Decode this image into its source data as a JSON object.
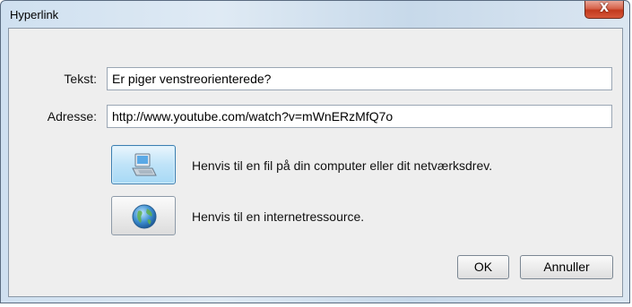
{
  "dialog": {
    "title": "Hyperlink",
    "close_glyph": "X"
  },
  "form": {
    "text_label": "Tekst:",
    "text_value": "Er piger venstreorienterede?",
    "address_label": "Adresse:",
    "address_value": "http://www.youtube.com/watch?v=mWnERzMfQ7o"
  },
  "link_options": [
    {
      "icon": "computer-icon",
      "label": "Henvis til en fil på din computer eller dit netværksdrev.",
      "selected": true
    },
    {
      "icon": "globe-icon",
      "label": "Henvis til en internetressource.",
      "selected": false
    }
  ],
  "buttons": {
    "ok": "OK",
    "cancel": "Annuller"
  }
}
